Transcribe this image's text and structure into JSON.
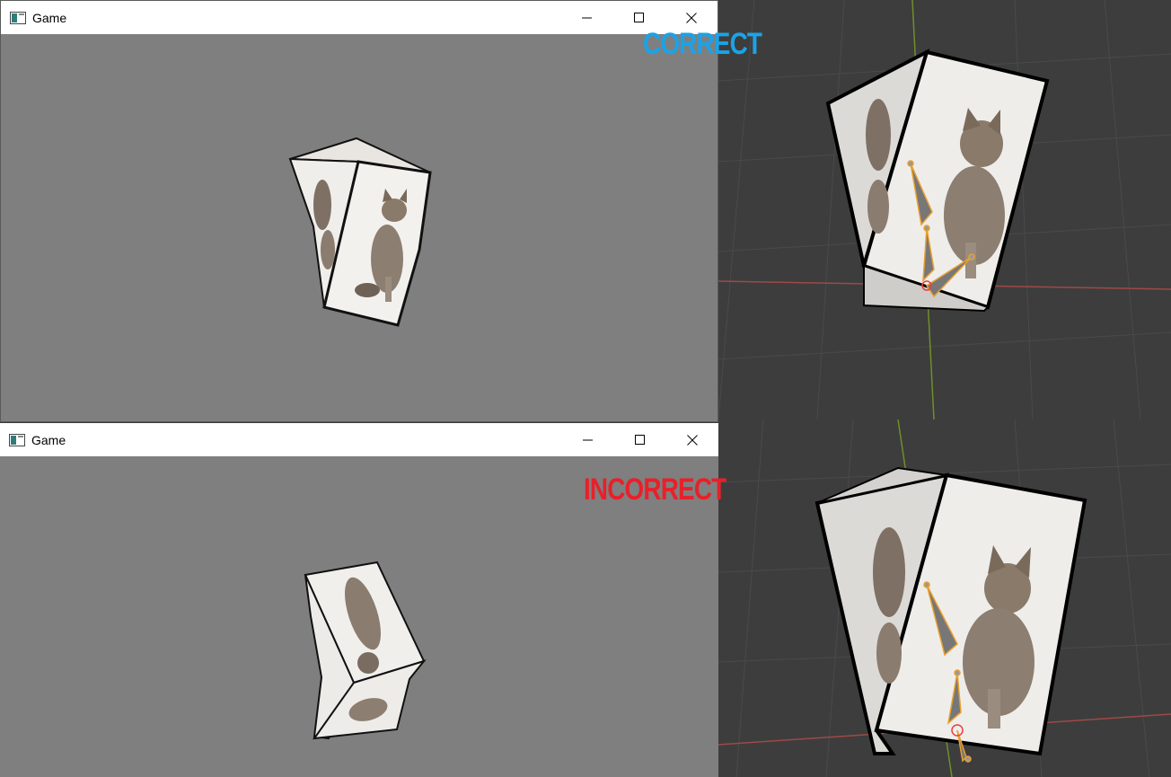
{
  "windows": [
    {
      "title": "Game",
      "icon": "app-window-icon",
      "controls": [
        "minimize-icon",
        "maximize-icon",
        "close-icon"
      ]
    },
    {
      "title": "Game",
      "icon": "app-window-icon",
      "controls": [
        "minimize-icon",
        "maximize-icon",
        "close-icon"
      ]
    }
  ],
  "labels": {
    "correct": "CORRECT",
    "incorrect": "INCORRECT"
  },
  "colors": {
    "correct": "#1aa3e8",
    "incorrect": "#e8202a",
    "viewport_bg": "#7f7f7f",
    "blender_bg": "#3d3d3d",
    "bone": "#e8a030"
  }
}
